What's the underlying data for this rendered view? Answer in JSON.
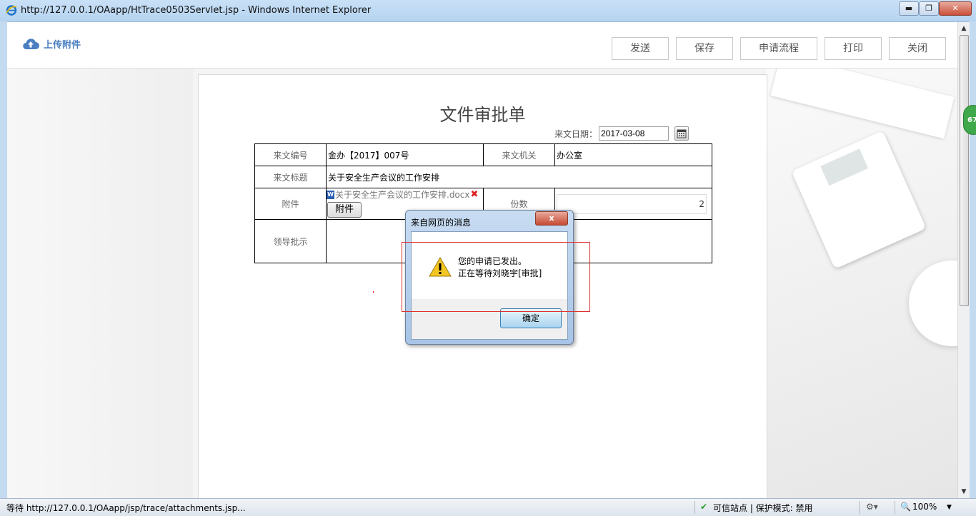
{
  "window": {
    "title": "http://127.0.0.1/OAapp/HtTrace0503Servlet.jsp - Windows Internet Explorer",
    "controls": [
      "minimize-icon",
      "maximize-icon",
      "close-icon"
    ]
  },
  "toolbar": {
    "upload_label": "上传附件",
    "buttons": [
      "发送",
      "保存",
      "申请流程",
      "打印",
      "关闭"
    ]
  },
  "form": {
    "title": "文件审批单",
    "date_label": "来文日期：",
    "date_value": "2017-03-08",
    "rows": {
      "doc_number_label": "来文编号",
      "doc_number_value": "金办【2017】007号",
      "org_label": "来文机关",
      "org_value": "办公室",
      "subject_label": "来文标题",
      "subject_value": "关于安全生产会议的工作安排",
      "attachment_label": "附件",
      "attachment_file": "关于安全生产会议的工作安排.docx",
      "attachment_button": "附件",
      "copies_label": "份数",
      "copies_value": "2",
      "leader_label": "领导批示"
    }
  },
  "dialog": {
    "title": "来自网页的消息",
    "close": "x",
    "line1": "您的申请已发出。",
    "line2": "正在等待刘晓宇[审批]",
    "ok_label": "确定"
  },
  "sidebar_badge": "67",
  "statusbar": {
    "url": "等待 http://127.0.0.1/OAapp/jsp/trace/attachments.jsp...",
    "security": "可信站点 | 保护模式: 禁用",
    "zoom": "100%"
  },
  "colors": {
    "accent": "#4a7fc1",
    "badge": "#3ea84a",
    "highlight_box": "#e03030"
  }
}
